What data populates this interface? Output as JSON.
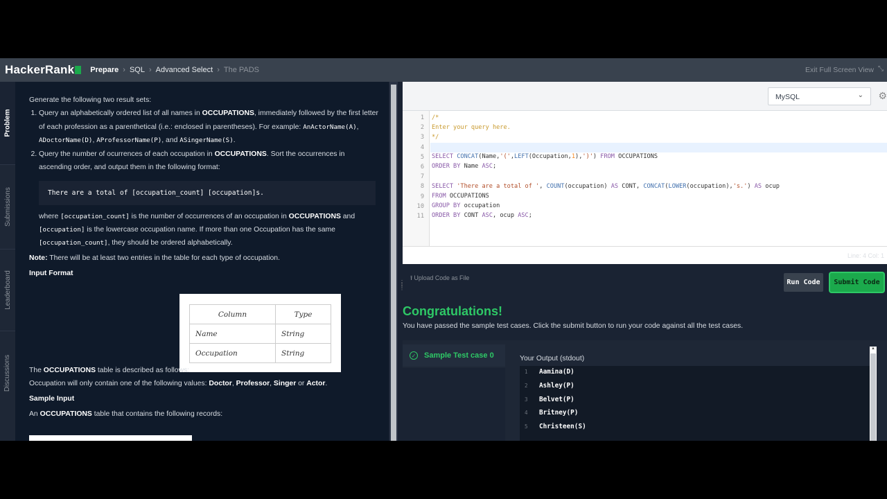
{
  "nav": {
    "logo": "HackerRank",
    "breadcrumbs": [
      "Prepare",
      "SQL",
      "Advanced Select",
      "The PADS"
    ],
    "exit_fullscreen": "Exit Full Screen View",
    "accent": "#1ba94c"
  },
  "rail": {
    "tabs": [
      "Problem",
      "Submissions",
      "Leaderboard",
      "Discussions"
    ]
  },
  "problem": {
    "intro": "Generate the following two result sets:",
    "item1": {
      "a": "Query an alphabetically ordered list of all names in ",
      "b": "OCCUPATIONS",
      "c": ", immediately followed by the first letter of each profession as a parenthetical (i.e.: enclosed in parentheses). For example: ",
      "ex1": "AnActorName(A)",
      "s1": ", ",
      "ex2": "ADoctorName(D)",
      "s2": ", ",
      "ex3": "AProfessorName(P)",
      "s3": ", and ",
      "ex4": "ASingerName(S)",
      "end": "."
    },
    "item2": {
      "a": "Query the number of ocurrences of each occupation in ",
      "b": "OCCUPATIONS",
      "c": ". Sort the occurrences in ascending order, and output them in the following format:"
    },
    "format_code": "There are a total of [occupation_count] [occupation]s.",
    "where": {
      "a": "where ",
      "code1": "[occupation_count]",
      "b": " is the number of occurrences of an occupation in ",
      "c": "OCCUPATIONS",
      "d": " and ",
      "code2": "[occupation]",
      "e": " is the lowercase occupation name. If more than one Occupation has the same ",
      "code3": "[occupation_count]",
      "f": ", they should be ordered alphabetically."
    },
    "note_label": "Note:",
    "note_text": " There will be at least two entries in the table for each type of occupation.",
    "input_format": "Input Format",
    "table_desc_a": "The ",
    "table_desc_b": "OCCUPATIONS",
    "table_desc_c": " table is described as follows:",
    "values_a": "Occupation will only contain one of the following values: ",
    "values": [
      "Doctor",
      "Professor",
      "Singer",
      "Actor"
    ],
    "values_sep1": ", ",
    "values_sep2": ", ",
    "values_sep3": " or ",
    "values_end": ".",
    "sample_input": "Sample Input",
    "sample_desc_a": "An ",
    "sample_desc_b": "OCCUPATIONS",
    "sample_desc_c": " table that contains the following records:",
    "schema": {
      "headers": [
        "Column",
        "Type"
      ],
      "rows": [
        [
          "Name",
          "String"
        ],
        [
          "Occupation",
          "String"
        ]
      ]
    }
  },
  "editor": {
    "language": "MySQL",
    "line_numbers": [
      "1",
      "2",
      "3",
      "4",
      "5",
      "6",
      "7",
      "8",
      "9",
      "10",
      "11"
    ],
    "status": "Line: 4 Col: 1"
  },
  "actions": {
    "upload": "Upload Code as File",
    "run": "Run Code",
    "submit": "Submit Code"
  },
  "result": {
    "title": "Congratulations!",
    "subtitle": "You have passed the sample test cases. Click the submit button to run your code against all the test cases.",
    "case_label": "Sample Test case 0",
    "output_label": "Your Output (stdout)",
    "output_lines": [
      {
        "n": "1",
        "t": "Aamina(D)"
      },
      {
        "n": "2",
        "t": "Ashley(P)"
      },
      {
        "n": "3",
        "t": "Belvet(P)"
      },
      {
        "n": "4",
        "t": "Britney(P)"
      },
      {
        "n": "5",
        "t": "Christeen(S)"
      }
    ]
  }
}
